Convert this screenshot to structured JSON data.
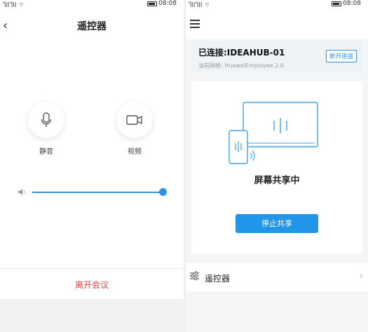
{
  "left": {
    "status": {
      "signal": "ᴬ⺢ᴬ⺢",
      "time": "08:08"
    },
    "title": "遥控器",
    "mute_label": "静音",
    "video_label": "视频",
    "volume_fraction": 1.0,
    "leave_label": "离开会议"
  },
  "right": {
    "status": {
      "time": "08:08"
    },
    "connection": {
      "title": "已连接:IDEAHUB-01",
      "network": "当前网络: HuaweiEmployee 2.0",
      "disconnect_label": "断开连接"
    },
    "share_status": "屏幕共享中",
    "stop_share_label": "停止共享",
    "remote_label": "遥控器"
  },
  "colors": {
    "accent": "#2196e8",
    "danger": "#e3433d"
  }
}
